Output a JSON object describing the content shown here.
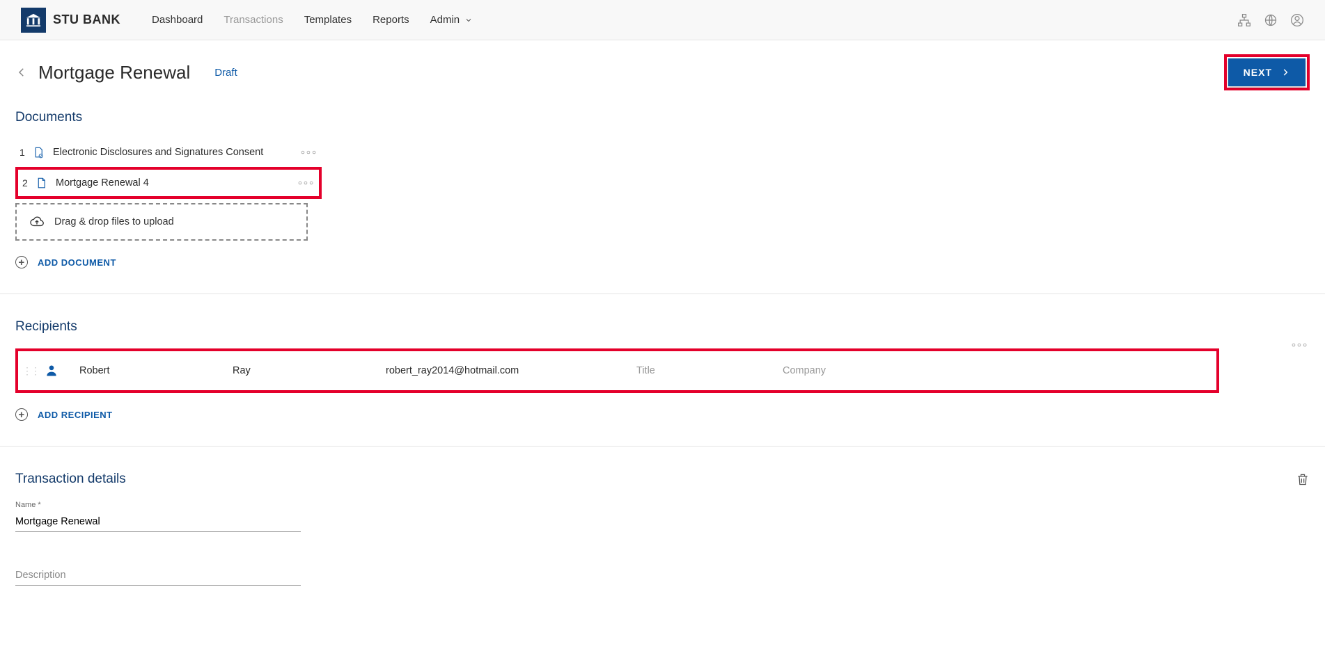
{
  "brand": {
    "name": "STU BANK"
  },
  "nav": {
    "dashboard": "Dashboard",
    "transactions": "Transactions",
    "templates": "Templates",
    "reports": "Reports",
    "admin": "Admin"
  },
  "header": {
    "title": "Mortgage Renewal",
    "status": "Draft",
    "next": "NEXT"
  },
  "documents": {
    "title": "Documents",
    "items": [
      {
        "num": "1",
        "name": "Electronic Disclosures and Signatures Consent"
      },
      {
        "num": "2",
        "name": "Mortgage Renewal 4"
      }
    ],
    "dropzone": "Drag & drop files to upload",
    "add": "ADD DOCUMENT"
  },
  "recipients": {
    "title": "Recipients",
    "row": {
      "first": "Robert",
      "last": "Ray",
      "email": "robert_ray2014@hotmail.com",
      "title_ph": "Title",
      "company_ph": "Company"
    },
    "add": "ADD RECIPIENT"
  },
  "details": {
    "title": "Transaction details",
    "name_label": "Name *",
    "name_value": "Mortgage Renewal",
    "desc_ph": "Description"
  }
}
